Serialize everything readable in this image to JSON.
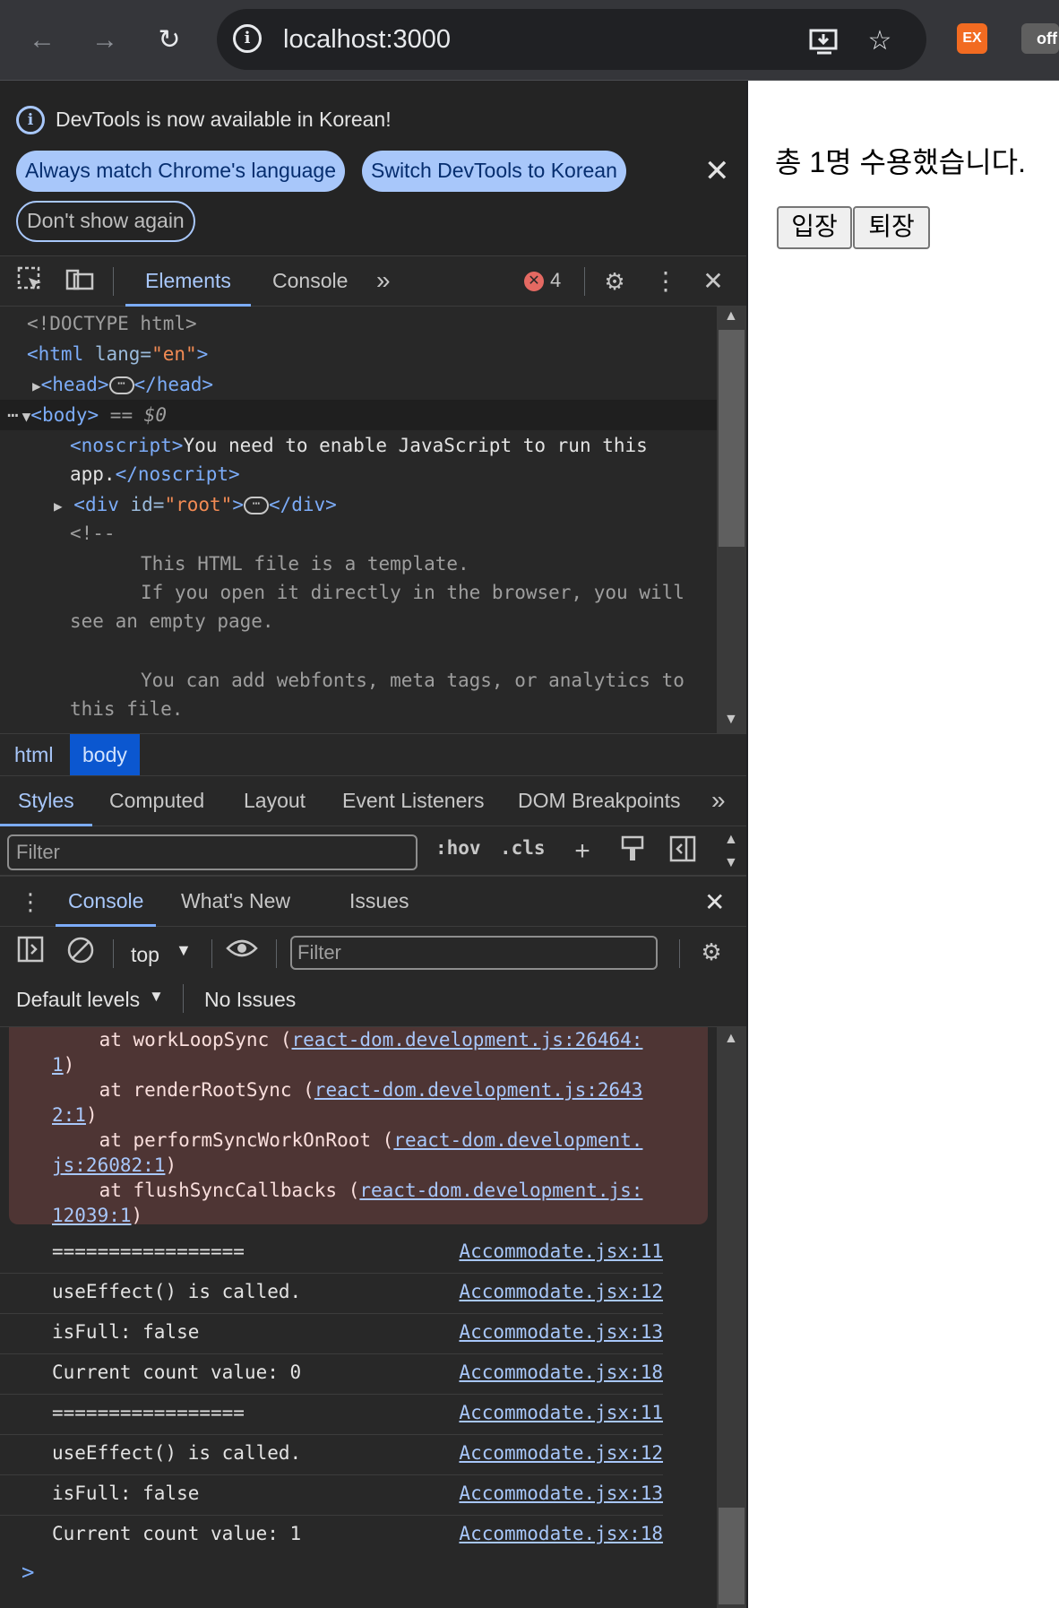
{
  "browser": {
    "url": "localhost:3000",
    "back_icon": "arrow-left-icon",
    "forward_icon": "arrow-right-icon",
    "reload_icon": "reload-icon",
    "ext1_label": "EX",
    "ext2_label": "off"
  },
  "infobar": {
    "message": "DevTools is now available in Korean!",
    "btn_match": "Always match Chrome's language",
    "btn_switch": "Switch DevTools to Korean",
    "btn_dont_show": "Don't show again"
  },
  "toolbar": {
    "tabs": [
      "Elements",
      "Console"
    ],
    "more": "»",
    "error_count": "4"
  },
  "dom": {
    "doctype": "<!DOCTYPE html>",
    "html_open": "<html",
    "html_attr": " lang=",
    "html_attr_val": "\"en\"",
    "head_open": "<head>",
    "head_close": "</head>",
    "body_open": "<body>",
    "body_suffix": " == $0",
    "noscript_open": "<noscript>",
    "noscript_text1": "You need to enable JavaScript to run this",
    "noscript_text2": "app.",
    "noscript_close": "</noscript>",
    "div_open": "<div",
    "div_attr": " id=",
    "div_attr_val": "\"root\"",
    "div_close": "</div>",
    "comment_open": "<!--",
    "comment_l1": "This HTML file is a template.",
    "comment_l2": "If you open it directly in the browser, you will",
    "comment_l3": "see an empty page.",
    "comment_l4": "You can add webfonts, meta tags, or analytics to",
    "comment_l5": "this file."
  },
  "breadcrumbs": [
    "html",
    "body"
  ],
  "styles_tabs": [
    "Styles",
    "Computed",
    "Layout",
    "Event Listeners",
    "DOM Breakpoints"
  ],
  "styles_filter": {
    "placeholder": "Filter",
    "hov": ":hov",
    "cls": ".cls"
  },
  "drawer_tabs": [
    "Console",
    "What's New",
    "Issues"
  ],
  "console_toolbar": {
    "context": "top",
    "filter_placeholder": "Filter",
    "levels": "Default levels",
    "issues": "No Issues"
  },
  "error_stack": [
    {
      "prefix": "    at workLoopSync (",
      "link": "react-dom.development.js:26464:",
      "cont": "1",
      "suffix": ")"
    },
    {
      "prefix": "    at renderRootSync (",
      "link": "react-dom.development.js:2643",
      "cont": "2:1",
      "suffix": ")"
    },
    {
      "prefix": "    at performSyncWorkOnRoot (",
      "link": "react-dom.development.",
      "cont": "js:26082:1",
      "suffix": ")"
    },
    {
      "prefix": "    at flushSyncCallbacks (",
      "link": "react-dom.development.js:",
      "cont": "12039:1",
      "suffix": ")"
    }
  ],
  "logs": [
    {
      "msg": "=================",
      "src": "Accommodate.jsx:11"
    },
    {
      "msg": "useEffect() is called.",
      "src": "Accommodate.jsx:12"
    },
    {
      "msg": "isFull: false",
      "src": "Accommodate.jsx:13"
    },
    {
      "msg": "Current count value: 0",
      "src": "Accommodate.jsx:18"
    },
    {
      "msg": "=================",
      "src": "Accommodate.jsx:11"
    },
    {
      "msg": "useEffect() is called.",
      "src": "Accommodate.jsx:12"
    },
    {
      "msg": "isFull: false",
      "src": "Accommodate.jsx:13"
    },
    {
      "msg": "Current count value: 1",
      "src": "Accommodate.jsx:18"
    }
  ],
  "prompt": ">",
  "page": {
    "message": "총 1명 수용했습니다.",
    "btn_enter": "입장",
    "btn_exit": "퇴장"
  }
}
